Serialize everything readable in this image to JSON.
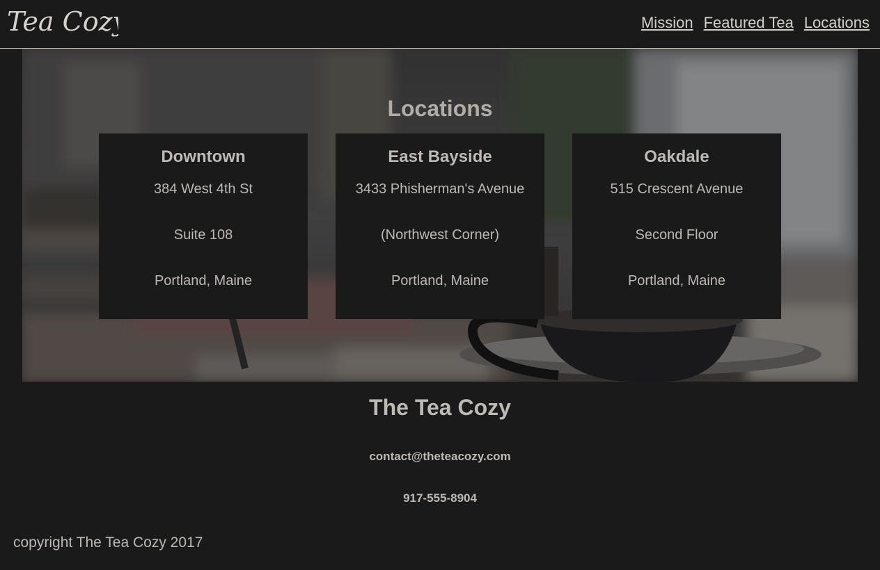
{
  "header": {
    "logo_text": "Tea Cozy",
    "nav": [
      "Mission",
      "Featured Tea",
      "Locations"
    ]
  },
  "hero": {
    "title": "Locations",
    "locations": [
      {
        "name": "Downtown",
        "line1": "384 West 4th St",
        "line2": "Suite 108",
        "line3": "Portland, Maine"
      },
      {
        "name": "East Bayside",
        "line1": "3433 Phisherman's Avenue",
        "line2": "(Northwest Corner)",
        "line3": "Portland, Maine"
      },
      {
        "name": "Oakdale",
        "line1": "515 Crescent Avenue",
        "line2": "Second Floor",
        "line3": "Portland, Maine"
      }
    ]
  },
  "footer": {
    "title": "The Tea Cozy",
    "email": "contact@theteacozy.com",
    "phone": "917-555-8904",
    "copyright": "copyright The Tea Cozy 2017"
  },
  "colors": {
    "background": "#1a1a1a",
    "text": "#bdb9b4",
    "header_border": "#cfc6b8"
  }
}
